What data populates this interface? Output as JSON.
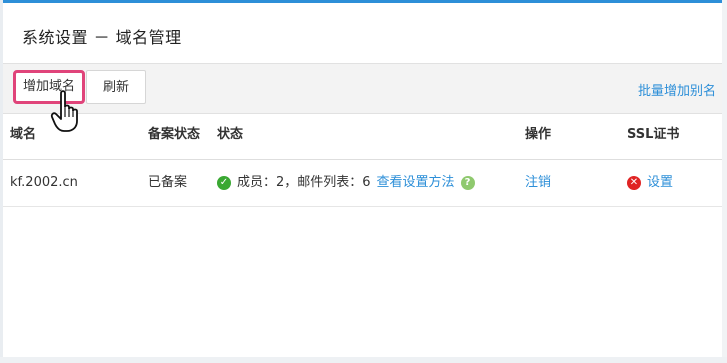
{
  "page": {
    "title": "系统设置 － 域名管理"
  },
  "toolbar": {
    "add_domain_label": "增加域名",
    "refresh_label": "刷新",
    "batch_alias_label": "批量增加别名"
  },
  "table": {
    "headers": [
      "域名",
      "备案状态",
      "状态",
      "操作",
      "SSL证书"
    ],
    "rows": [
      {
        "domain": "kf.2002.cn",
        "icp_status": "已备案",
        "status_text": "成员：2，邮件列表：6",
        "status_link": "查看设置方法",
        "action": "注销",
        "ssl_action": "设置"
      }
    ]
  },
  "icons": {
    "status_ok": "check-circle-icon",
    "help": "question-circle-icon",
    "ssl_error": "x-circle-icon",
    "cursor": "hand-pointer-icon"
  },
  "colors": {
    "accent": "#2d8fd8",
    "highlight": "#e0447a",
    "ok": "#3aa832",
    "error": "#e02424"
  }
}
